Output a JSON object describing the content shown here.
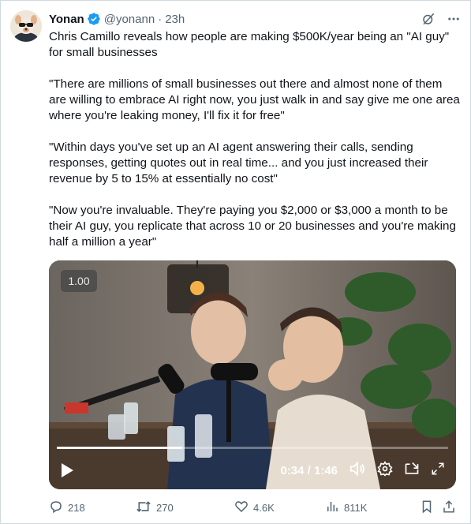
{
  "author": {
    "name": "Yonan",
    "handle": "@yonann",
    "separator": "·",
    "time": "23h"
  },
  "tweet": {
    "paragraphs": [
      "Chris Camillo reveals how people are making $500K/year being an \"AI guy\" for small businesses",
      "\"There are millions of small businesses out there and almost none of them are willing to embrace AI right now, you just walk in and say give me one area where you're leaking money, I'll fix it for free\"",
      "\"Within days you've set up an AI agent answering their calls, sending responses, getting quotes out in real time... and you just increased their revenue by 5 to 15% at essentially no cost\"",
      "\"Now you're invaluable. They're paying you $2,000 or $3,000 a month to be their AI guy, you replicate that across 10 or 20 businesses and you're making half a million a year\""
    ]
  },
  "video": {
    "speed": "1.00",
    "timecode": "0:34 / 1:46",
    "progress": 0.32
  },
  "actions": {
    "replies": "218",
    "reposts": "270",
    "likes": "4.6K",
    "views": "811K"
  },
  "colors": {
    "verified": "#1d9bf0",
    "text": "#0f1419",
    "muted": "#536471",
    "border": "#cfd9de"
  },
  "icons": {
    "grok": "grok-icon",
    "more": "more-icon",
    "reply": "reply-icon",
    "retweet": "retweet-icon",
    "like": "heart-icon",
    "views": "views-icon",
    "bookmark": "bookmark-icon",
    "share": "share-icon"
  }
}
